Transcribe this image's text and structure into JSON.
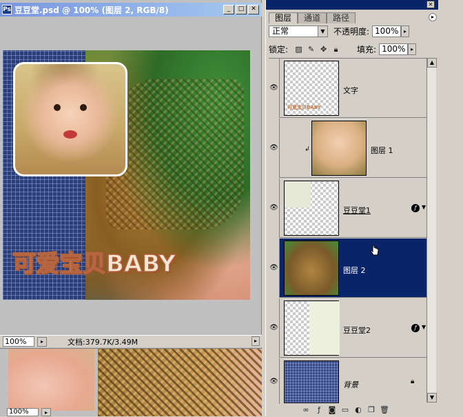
{
  "document": {
    "title": "豆豆堂.psd @ 100% (图层 2, RGB/8)",
    "zoom": "100%",
    "doc_info": "文档:379.7K/3.49M",
    "caption": "可爱宝贝BABY",
    "window_buttons": {
      "minimize": "_",
      "maximize": "□",
      "close": "✕"
    }
  },
  "second_document": {
    "zoom": "100%"
  },
  "layers_panel": {
    "tabs": [
      "图层",
      "通道",
      "路径"
    ],
    "active_tab": "图层",
    "blend_mode": "正常",
    "opacity_label": "不透明度:",
    "opacity_value": "100%",
    "lock_label": "锁定:",
    "fill_label": "填充:",
    "fill_value": "100%",
    "layers": [
      {
        "name": "文字",
        "visible": true,
        "fx": false,
        "selected": false,
        "thumb_text": "可爱宝贝BABY"
      },
      {
        "name": "图层 1",
        "visible": true,
        "fx": false,
        "selected": false,
        "clipped": true
      },
      {
        "name": "豆豆堂1",
        "visible": true,
        "fx": true,
        "selected": false
      },
      {
        "name": "图层 2",
        "visible": true,
        "fx": false,
        "selected": true
      },
      {
        "name": "豆豆堂2",
        "visible": true,
        "fx": true,
        "selected": false
      },
      {
        "name": "背景",
        "visible": true,
        "fx": false,
        "selected": false,
        "locked": true
      }
    ],
    "footer_icons": [
      "link-icon",
      "layer-style-icon",
      "mask-icon",
      "new-set-icon",
      "adjustment-icon",
      "new-layer-icon",
      "trash-icon"
    ]
  },
  "colors": {
    "selection": "#0a246a",
    "title_bar": "#7a96df",
    "pattern": "#2b3e78"
  }
}
